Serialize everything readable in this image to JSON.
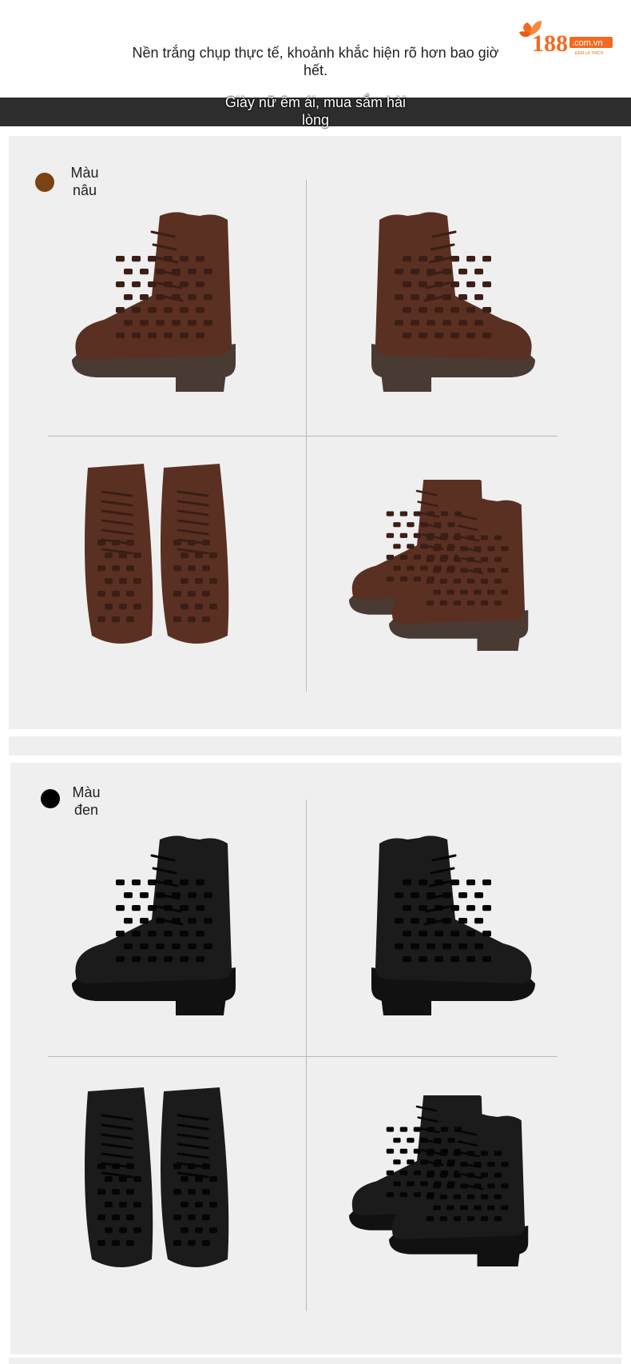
{
  "header": {
    "subtitle": "Nền trắng chụp thực tế, khoảnh khắc hiện rõ hơn bao giờ hết.",
    "band_text": "Giày nữ êm ái, mua sắm hài lòng",
    "logo": {
      "number": "188",
      "domain": ".com.vn",
      "tagline": "ĐEM LÀ THÍCH"
    }
  },
  "sections": [
    {
      "color_label": "Màu nâu",
      "swatch_color": "#7a4314",
      "boot_color": "#5a3022",
      "boot_dark": "#3b1e15",
      "sole": "#4a3a34"
    },
    {
      "color_label": "Màu đen",
      "swatch_color": "#000000",
      "boot_color": "#1b1b1b",
      "boot_dark": "#050505",
      "sole": "#111111"
    }
  ],
  "colors": {
    "panel_bg": "#efefef",
    "band_bg": "#2d2d2d",
    "logo_orange": "#f26a21"
  }
}
